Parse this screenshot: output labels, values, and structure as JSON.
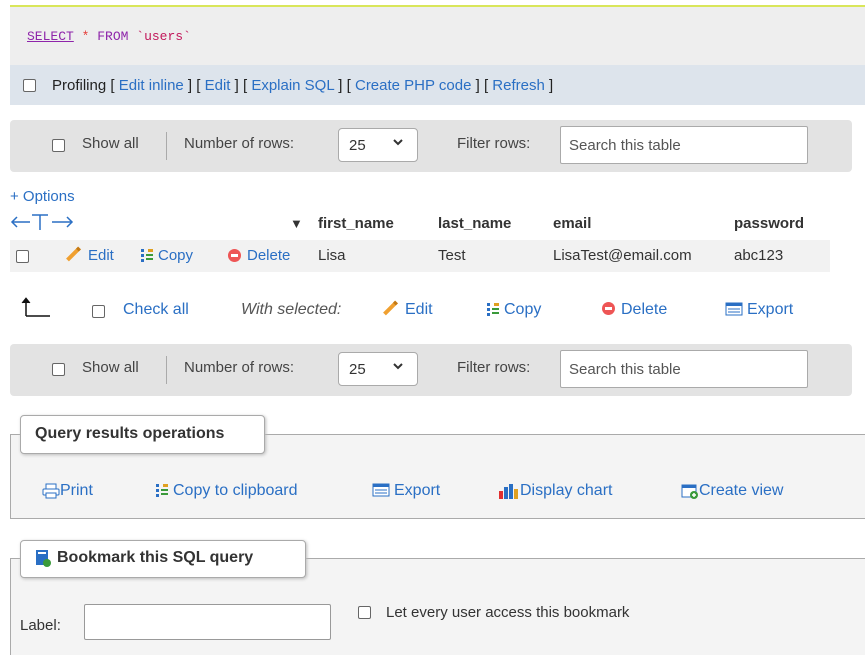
{
  "query": {
    "keyword": "SELECT",
    "star": "*",
    "from": "FROM",
    "table": "`users`"
  },
  "profiling": {
    "label": "Profiling",
    "links": [
      "Edit inline",
      "Edit",
      "Explain SQL",
      "Create PHP code",
      "Refresh"
    ]
  },
  "navigation": {
    "show_all": "Show all",
    "rows_label": "Number of rows:",
    "rows_value": "25",
    "filter_label": "Filter rows:",
    "search_placeholder": "Search this table"
  },
  "options_link": "+ Options",
  "table": {
    "headers": [
      "first_name",
      "last_name",
      "email",
      "password"
    ],
    "rows": [
      {
        "actions": {
          "edit": "Edit",
          "copy": "Copy",
          "delete": "Delete"
        },
        "cells": [
          "Lisa",
          "Test",
          "LisaTest@email.com",
          "abc123"
        ]
      }
    ]
  },
  "with_selected": {
    "check_all": "Check all",
    "label": "With selected:",
    "edit": "Edit",
    "copy": "Copy",
    "delete": "Delete",
    "export": "Export"
  },
  "query_ops": {
    "title": "Query results operations",
    "print": "Print",
    "copy_clipboard": "Copy to clipboard",
    "export": "Export",
    "display_chart": "Display chart",
    "create_view": "Create view"
  },
  "bookmark": {
    "title": "Bookmark this SQL query",
    "label": "Label:",
    "label_value": "",
    "let_every": "Let every user access this bookmark"
  },
  "colors": {
    "link": "#2a6fc4",
    "profiling_bg": "#dde4ec",
    "nav_bg": "#e3e3e3",
    "sql_keyword": "#8e24aa",
    "delete_red": "#e55555"
  }
}
